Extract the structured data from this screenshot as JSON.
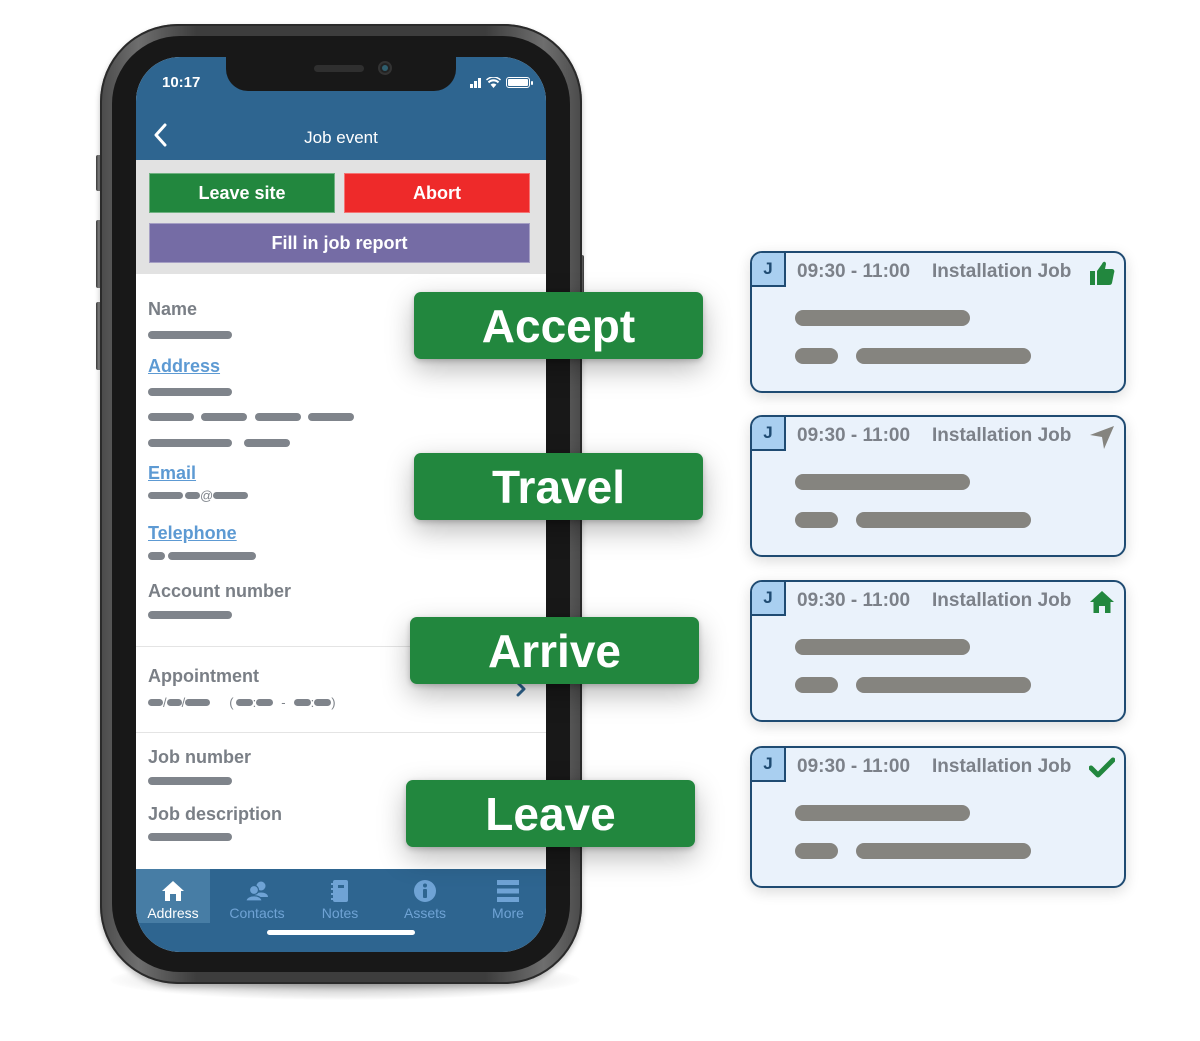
{
  "status_bar": {
    "time": "10:17"
  },
  "header": {
    "title": "Job event",
    "back_icon": "chevron-left-icon"
  },
  "actions": {
    "leave_site": "Leave site",
    "abort": "Abort",
    "fill_report": "Fill in job report"
  },
  "details": {
    "name_label": "Name",
    "address_label": "Address",
    "email_label": "Email",
    "email_at": "@",
    "telephone_label": "Telephone",
    "account_label": "Account number",
    "appointment_label": "Appointment",
    "appointment_sep_slash": "/",
    "appointment_open": "(",
    "appointment_colon": ":",
    "appointment_dash": "-",
    "appointment_close": ")",
    "job_number_label": "Job number",
    "job_description_label": "Job description"
  },
  "bottom_nav": {
    "items": [
      {
        "label": "Address",
        "icon": "home-icon",
        "active": true
      },
      {
        "label": "Contacts",
        "icon": "contacts-icon",
        "active": false
      },
      {
        "label": "Notes",
        "icon": "notebook-icon",
        "active": false
      },
      {
        "label": "Assets",
        "icon": "info-icon",
        "active": false
      },
      {
        "label": "More",
        "icon": "menu-icon",
        "active": false
      }
    ]
  },
  "stages": [
    {
      "label": "Accept"
    },
    {
      "label": "Travel"
    },
    {
      "label": "Arrive"
    },
    {
      "label": "Leave"
    }
  ],
  "job_cards": [
    {
      "badge": "J",
      "time": "09:30 - 11:00",
      "type": "Installation Job",
      "status_icon": "thumbs-up-icon",
      "status_color": "#22873e"
    },
    {
      "badge": "J",
      "time": "09:30 - 11:00",
      "type": "Installation Job",
      "status_icon": "navigation-arrow-icon",
      "status_color": "#85847f"
    },
    {
      "badge": "J",
      "time": "09:30 - 11:00",
      "type": "Installation Job",
      "status_icon": "home-icon",
      "status_color": "#22873e"
    },
    {
      "badge": "J",
      "time": "09:30 - 11:00",
      "type": "Installation Job",
      "status_icon": "checkmark-icon",
      "status_color": "#22873e"
    }
  ],
  "colors": {
    "brand_blue": "#2e6590",
    "success_green": "#22873e",
    "danger_red": "#ee2a2a",
    "report_purple": "#756ca5",
    "link_blue": "#5d9ad3"
  }
}
